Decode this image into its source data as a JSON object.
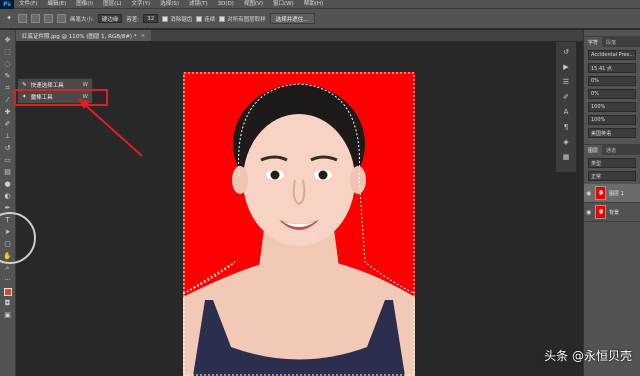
{
  "app": {
    "logo": "Ps"
  },
  "menu": [
    "文件(F)",
    "编辑(E)",
    "图像(I)",
    "图层(L)",
    "文字(Y)",
    "选择(S)",
    "滤镜(T)",
    "3D(D)",
    "视图(V)",
    "窗口(W)",
    "帮助(H)"
  ],
  "options": {
    "brush_size_label": "画笔大小:",
    "brush_size_value": "硬边缘",
    "tolerance_label": "容差:",
    "tolerance_value": "32",
    "antialias_label": "消除锯齿",
    "contiguous_label": "连续",
    "sample_all_label": "对所有图层取样",
    "select_mask_button": "选择并遮住..."
  },
  "document_tab": {
    "title": "红底证件照.jpg @ 110% (图层 1, RGB/8#) *",
    "close": "×"
  },
  "flyout": {
    "items": [
      {
        "label": "快速选择工具",
        "key": "W"
      },
      {
        "label": "魔棒工具",
        "key": "W"
      }
    ]
  },
  "right_panel": {
    "tabs": [
      "字符",
      "段落"
    ],
    "font_family": "Accidental Pres...",
    "font_size": "15.41 点",
    "leading": "0%",
    "tracking": "0%",
    "scale": "100%",
    "baseline": "100%",
    "language": "美国英语",
    "layers_tabs": [
      "图层",
      "通道"
    ],
    "filter_label": "类型",
    "blend_mode": "正常",
    "layers": [
      {
        "name": "图层 1",
        "selected": true
      },
      {
        "name": "背景",
        "selected": false
      }
    ]
  },
  "watermark": "头条 @永恒贝壳",
  "colors": {
    "canvas_bg": "#ff0000",
    "highlight": "#e02020",
    "fg_swatch": "#d64b2a"
  }
}
